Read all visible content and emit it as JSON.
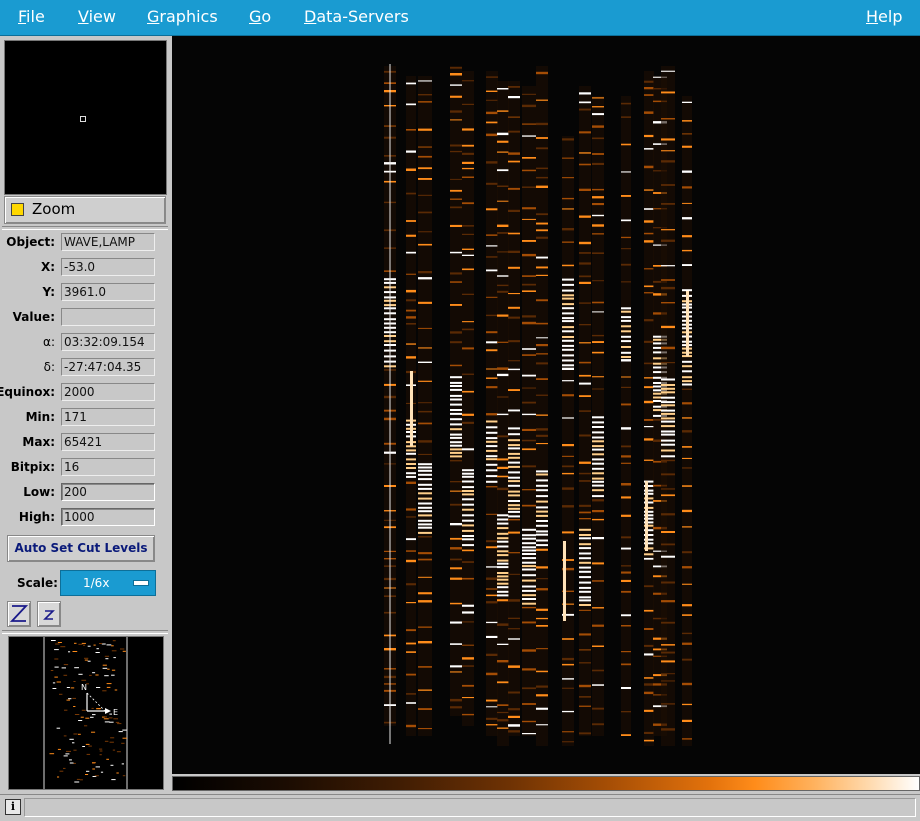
{
  "menubar": {
    "items": [
      {
        "key": "F",
        "rest": "ile"
      },
      {
        "key": "V",
        "rest": "iew"
      },
      {
        "key": "G",
        "rest": "raphics"
      },
      {
        "key": "G",
        "rest": "o"
      },
      {
        "key": "D",
        "rest": "ata-Servers"
      }
    ],
    "help": {
      "key": "H",
      "rest": "elp"
    },
    "color": "#1a9bd1"
  },
  "zoom": {
    "label": "Zoom",
    "checked": true
  },
  "fields": [
    {
      "label": "Object:",
      "value": "WAVE,LAMP"
    },
    {
      "label": "X:",
      "value": "-53.0"
    },
    {
      "label": "Y:",
      "value": "3961.0"
    },
    {
      "label": "Value:",
      "value": ""
    },
    {
      "label": "α:",
      "value": "03:32:09.154"
    },
    {
      "label": "δ:",
      "value": "-27:47:04.35"
    },
    {
      "label": "Equinox:",
      "value": "2000"
    },
    {
      "label": "Min:",
      "value": "171"
    },
    {
      "label": "Max:",
      "value": "65421"
    },
    {
      "label": "Bitpix:",
      "value": "16"
    },
    {
      "label": "Low:",
      "value": "200"
    },
    {
      "label": "High:",
      "value": "1000"
    }
  ],
  "auto_button": "Auto Set Cut Levels",
  "scale": {
    "label": "Scale:",
    "value": "1/6x"
  },
  "zoom_buttons": {
    "zoom_in": "Z",
    "zoom_out": "z"
  },
  "compass": {
    "north": "N",
    "east": "E"
  },
  "status": {
    "info_icon": "i",
    "text": ""
  },
  "colors": {
    "accent": "#1a9bd1",
    "panel": "#c8c8c8",
    "emission": "#ff8c1a"
  }
}
